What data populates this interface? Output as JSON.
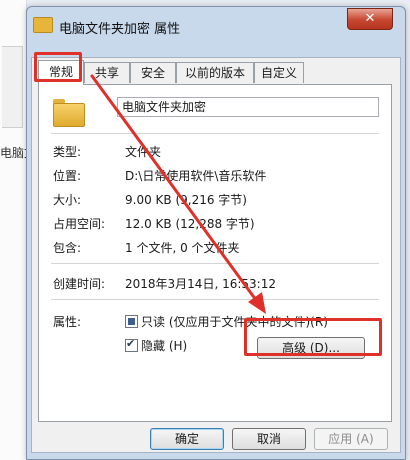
{
  "background": {
    "file_label": "电脑文件夹加密"
  },
  "dialog": {
    "title": "电脑文件夹加密 属性",
    "close_glyph": "✕",
    "tabs": [
      {
        "label": "常规"
      },
      {
        "label": "共享"
      },
      {
        "label": "安全"
      },
      {
        "label": "以前的版本"
      },
      {
        "label": "自定义"
      }
    ],
    "general": {
      "name_value": "电脑文件夹加密",
      "type_label": "类型:",
      "type_value": "文件夹",
      "location_label": "位置:",
      "location_value": "D:\\日常使用软件\\音乐软件",
      "size_label": "大小:",
      "size_value": "9.00 KB (9,216 字节)",
      "disk_size_label": "占用空间:",
      "disk_size_value": "12.0 KB (12,288 字节)",
      "contains_label": "包含:",
      "contains_value": "1 个文件, 0 个文件夹",
      "created_label": "创建时间:",
      "created_value": "2018年3月14日, 16:53:12",
      "attributes_label": "属性:",
      "readonly_label": "只读 (仅应用于文件夹中的文件)(R)",
      "hidden_label": "隐藏 (H)",
      "advanced_label": "高级 (D)..."
    },
    "footer": {
      "ok": "确定",
      "cancel": "取消",
      "apply": "应用 (A)"
    }
  },
  "annotation": {
    "color": "#e0302a"
  }
}
